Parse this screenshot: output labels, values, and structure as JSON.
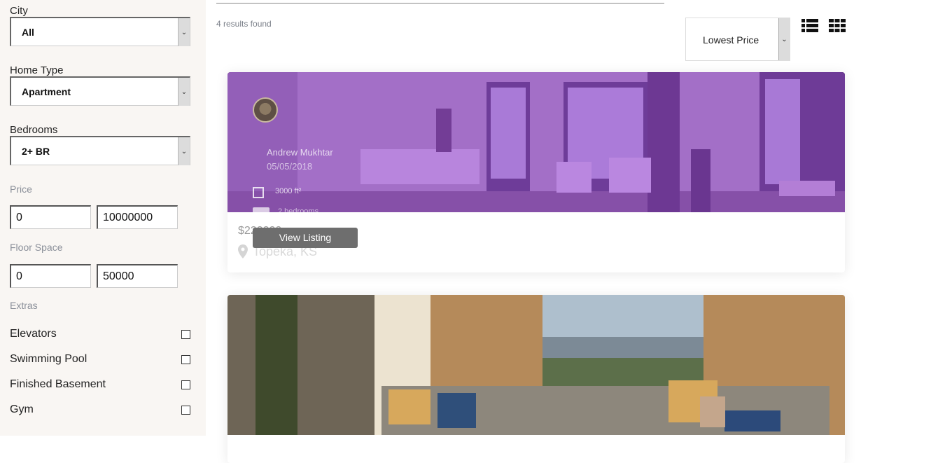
{
  "filters": {
    "city": {
      "label": "City",
      "value": "All"
    },
    "home_type": {
      "label": "Home Type",
      "value": "Apartment"
    },
    "bedrooms": {
      "label": "Bedrooms",
      "value": "2+ BR"
    },
    "price": {
      "label": "Price",
      "min": "0",
      "max": "10000000"
    },
    "floor_space": {
      "label": "Floor Space",
      "min": "0",
      "max": "50000"
    },
    "extras_label": "Extras",
    "extras": [
      {
        "label": "Elevators",
        "checked": false
      },
      {
        "label": "Swimming Pool",
        "checked": false
      },
      {
        "label": "Finished Basement",
        "checked": false
      },
      {
        "label": "Gym",
        "checked": false
      }
    ]
  },
  "results": {
    "count_text": "4 results found"
  },
  "sort": {
    "value": "Lowest Price"
  },
  "view_toggle": {
    "icons": [
      "list-view-icon",
      "grid-view-icon"
    ]
  },
  "listings": [
    {
      "agent": "Andrew Mukhtar",
      "date": "05/05/2018",
      "sqft": "3000 ft²",
      "bedrooms": "2 bedrooms",
      "price": "$220000",
      "location": "Topeka, KS",
      "cta": "View Listing",
      "overlay_color": "#9646d7"
    },
    {
      "overlay_color": ""
    }
  ]
}
